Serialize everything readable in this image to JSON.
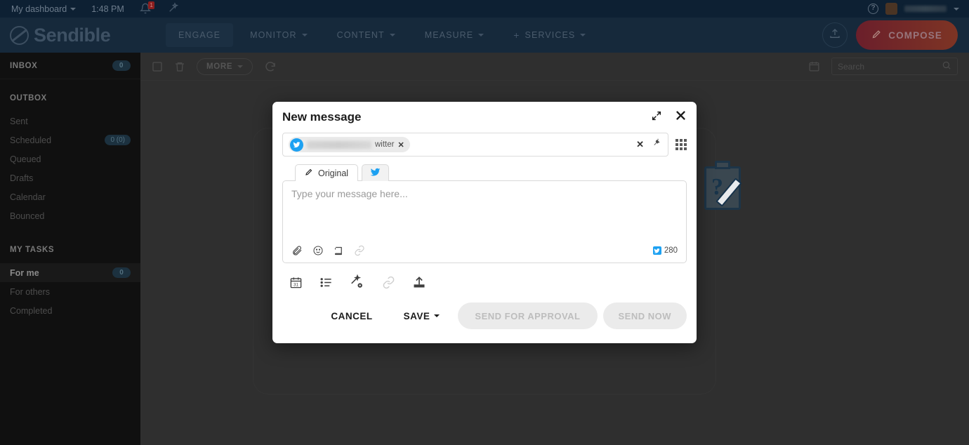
{
  "topbar": {
    "dashboard_label": "My dashboard",
    "time": "1:48 PM",
    "notification_count": "1",
    "bell_icon": "bell-icon",
    "wand_icon": "magic-wand-icon",
    "help_icon": "question-mark-icon",
    "user_name": ""
  },
  "brand": {
    "name": "Sendible",
    "logo_icon": "sendible-logo-icon"
  },
  "nav": {
    "items": [
      {
        "label": "ENGAGE",
        "active": true,
        "has_caret": false,
        "has_plus": false
      },
      {
        "label": "MONITOR",
        "active": false,
        "has_caret": true,
        "has_plus": false
      },
      {
        "label": "CONTENT",
        "active": false,
        "has_caret": true,
        "has_plus": false
      },
      {
        "label": "MEASURE",
        "active": false,
        "has_caret": true,
        "has_plus": false
      },
      {
        "label": "SERVICES",
        "active": false,
        "has_caret": true,
        "has_plus": true
      }
    ],
    "import_icon": "upload-icon",
    "compose_label": "COMPOSE",
    "compose_icon": "pencil-icon",
    "compose_color": "#7d2a28"
  },
  "sidebar": {
    "inbox": {
      "label": "INBOX",
      "count": "0"
    },
    "outbox": {
      "label": "OUTBOX",
      "items": [
        {
          "label": "Sent",
          "count": ""
        },
        {
          "label": "Scheduled",
          "count": "0 (0)"
        },
        {
          "label": "Queued",
          "count": ""
        },
        {
          "label": "Drafts",
          "count": ""
        },
        {
          "label": "Calendar",
          "count": ""
        },
        {
          "label": "Bounced",
          "count": ""
        }
      ]
    },
    "my_tasks": {
      "label": "MY TASKS",
      "items": [
        {
          "label": "For me",
          "count": "0",
          "selected": true
        },
        {
          "label": "For others",
          "count": "",
          "selected": false
        },
        {
          "label": "Completed",
          "count": "",
          "selected": false
        }
      ]
    }
  },
  "toolbar": {
    "select_all_icon": "checkbox-icon",
    "delete_icon": "trash-icon",
    "more_label": "MORE",
    "refresh_icon": "refresh-icon",
    "calendar_icon": "calendar-icon",
    "search_placeholder": "Search",
    "search_value": "",
    "search_icon": "search-icon"
  },
  "modal": {
    "title": "New message",
    "expand_icon": "expand-icon",
    "close_icon": "close-icon",
    "recipient": {
      "chip_label": "witter",
      "chip_remove_icon": "remove-chip-icon",
      "chip_avatar_icon": "twitter-icon",
      "clear_icon": "clear-icon",
      "pin_icon": "pin-icon",
      "grid_icon": "grid-apps-icon"
    },
    "tabs": [
      {
        "label": "Original",
        "icon": "pencil-icon",
        "active": true
      },
      {
        "label": "",
        "icon": "twitter-icon",
        "active": false
      }
    ],
    "composer": {
      "placeholder": "Type your message here...",
      "value": "",
      "attach_icon": "paperclip-icon",
      "emoji_icon": "emoji-icon",
      "library_icon": "content-library-icon",
      "shorten_icon": "link-shorten-icon",
      "char_count": "280",
      "char_count_icon": "twitter-icon"
    },
    "tools": [
      {
        "icon": "calendar-schedule-icon",
        "label": "31",
        "dim": false
      },
      {
        "icon": "queue-list-icon",
        "label": "",
        "dim": false
      },
      {
        "icon": "magic-settings-icon",
        "label": "",
        "dim": false
      },
      {
        "icon": "attachment-clip-icon",
        "label": "",
        "dim": true
      },
      {
        "icon": "upload-media-icon",
        "label": "",
        "dim": false
      }
    ],
    "footer": {
      "cancel_label": "CANCEL",
      "save_label": "SAVE",
      "send_approval_label": "SEND FOR APPROVAL",
      "send_now_label": "SEND NOW"
    }
  },
  "background": {
    "empty_state_icon": "clipboard-question-icon"
  }
}
